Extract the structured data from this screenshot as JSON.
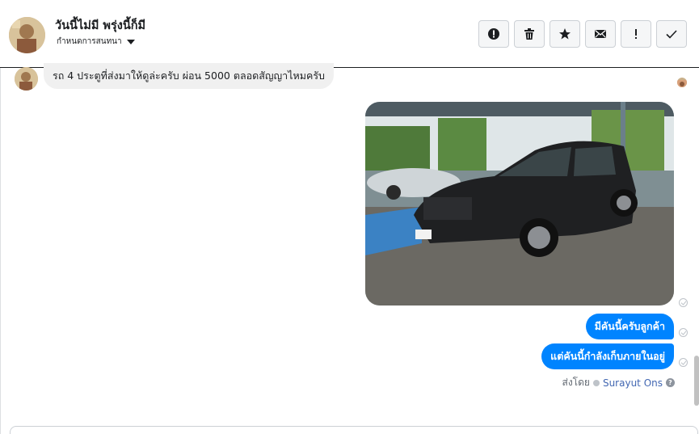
{
  "header": {
    "name": "วันนี้ไม่มี พรุ่งนี้ก็มี",
    "status": "กำหนดการสนทนา",
    "actions": [
      {
        "name": "report-button",
        "icon": "exclamation-circle-icon"
      },
      {
        "name": "delete-button",
        "icon": "trash-icon"
      },
      {
        "name": "star-button",
        "icon": "star-icon"
      },
      {
        "name": "mark-unread-button",
        "icon": "envelope-icon"
      },
      {
        "name": "important-button",
        "icon": "exclamation-icon",
        "label": "!"
      },
      {
        "name": "done-button",
        "icon": "checkmark-icon"
      }
    ]
  },
  "messages": {
    "incoming_text": "รถ 4 ประตูที่ส่งมาให้ดูล่ะครับ ผ่อน 5000 ตลอดสัญญาไหมครับ",
    "outgoing": [
      "มีคันนี้ครับลูกค้า",
      "แต่คันนี้กำลังเก็บภายในอยู่"
    ],
    "sent_by_label": "ส่งโดย",
    "sent_by_name": "Surayut Ons",
    "help_icon_text": "?"
  },
  "colors": {
    "accent": "#0084ff",
    "incoming_bubble": "#f0f0f0",
    "link": "#4267b2"
  }
}
